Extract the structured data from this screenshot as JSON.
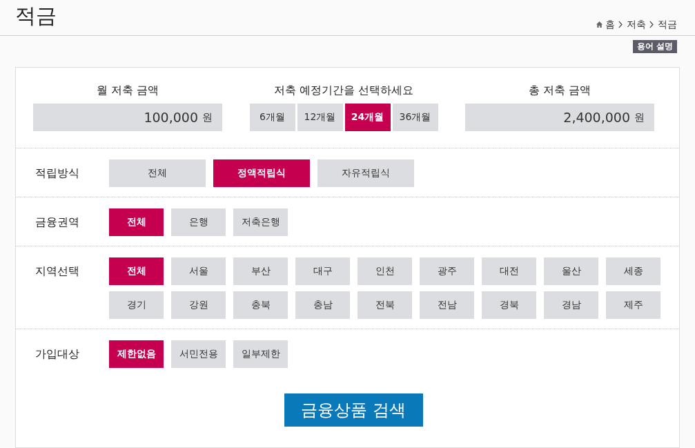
{
  "page": {
    "title": "적금"
  },
  "breadcrumb": [
    {
      "kind": "home",
      "label": "홈"
    },
    {
      "kind": "link",
      "label": "저축"
    },
    {
      "kind": "current",
      "label": "적금"
    }
  ],
  "glossary_button": "용어 설명",
  "summary": {
    "monthly_amount": {
      "label": "월 저축 금액",
      "value": "100,000",
      "unit": "원"
    },
    "period": {
      "label": "저축 예정기간을 선택하세요",
      "options": [
        {
          "label": "6개월",
          "selected": false
        },
        {
          "label": "12개월",
          "selected": false
        },
        {
          "label": "24개월",
          "selected": true
        },
        {
          "label": "36개월",
          "selected": false
        }
      ]
    },
    "total_amount": {
      "label": "총 저축 금액",
      "value": "2,400,000",
      "unit": "원"
    }
  },
  "filters": [
    {
      "label": "적립방식",
      "kind": "wide",
      "options": [
        {
          "label": "전체",
          "selected": false
        },
        {
          "label": "정액적립식",
          "selected": true
        },
        {
          "label": "자유적립식",
          "selected": false
        }
      ]
    },
    {
      "label": "금융권역",
      "kind": "compact",
      "options": [
        {
          "label": "전체",
          "selected": true
        },
        {
          "label": "은행",
          "selected": false
        },
        {
          "label": "저축은행",
          "selected": false
        }
      ]
    },
    {
      "label": "지역선택",
      "kind": "compact",
      "options": [
        {
          "label": "전체",
          "selected": true
        },
        {
          "label": "서울",
          "selected": false
        },
        {
          "label": "부산",
          "selected": false
        },
        {
          "label": "대구",
          "selected": false
        },
        {
          "label": "인천",
          "selected": false
        },
        {
          "label": "광주",
          "selected": false
        },
        {
          "label": "대전",
          "selected": false
        },
        {
          "label": "울산",
          "selected": false
        },
        {
          "label": "세종",
          "selected": false
        },
        {
          "label": "경기",
          "selected": false
        },
        {
          "label": "강원",
          "selected": false
        },
        {
          "label": "충북",
          "selected": false
        },
        {
          "label": "충남",
          "selected": false
        },
        {
          "label": "전북",
          "selected": false
        },
        {
          "label": "전남",
          "selected": false
        },
        {
          "label": "경북",
          "selected": false
        },
        {
          "label": "경남",
          "selected": false
        },
        {
          "label": "제주",
          "selected": false
        }
      ]
    },
    {
      "label": "가입대상",
      "kind": "compact",
      "options": [
        {
          "label": "제한없음",
          "selected": true
        },
        {
          "label": "서민전용",
          "selected": false
        },
        {
          "label": "일부제한",
          "selected": false
        }
      ]
    }
  ],
  "search_button": "금융상품 검색"
}
